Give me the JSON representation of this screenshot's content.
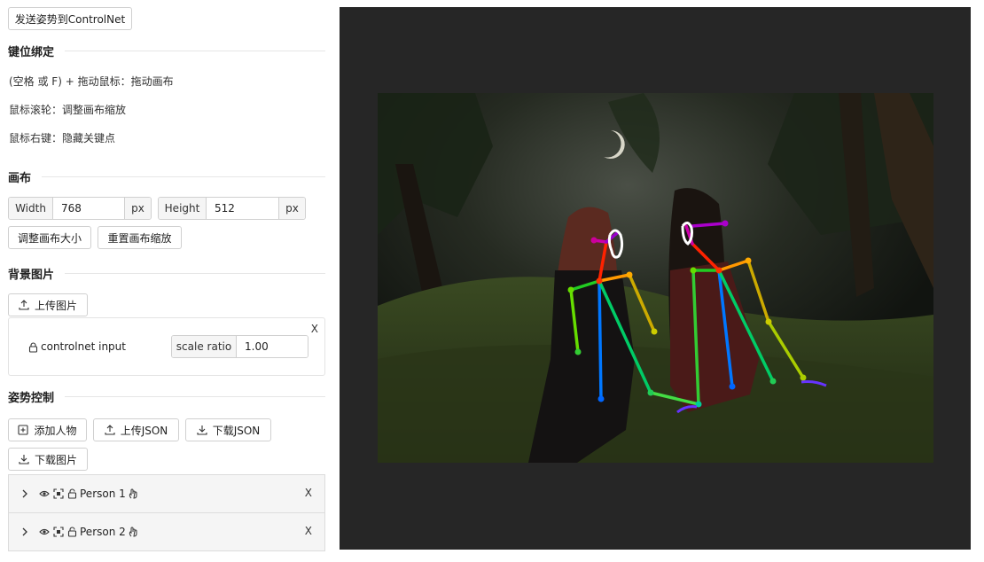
{
  "toolbar": {
    "send_label": "发送姿势到ControlNet"
  },
  "keybindings": {
    "title": "键位绑定",
    "items": [
      "(空格 或 F) + 拖动鼠标：拖动画布",
      "鼠标滚轮：调整画布缩放",
      "鼠标右键：隐藏关键点"
    ]
  },
  "canvas_section": {
    "title": "画布",
    "width_label": "Width",
    "width_value": "768",
    "width_unit": "px",
    "height_label": "Height",
    "height_value": "512",
    "height_unit": "px",
    "resize_label": "调整画布大小",
    "reset_zoom_label": "重置画布缩放"
  },
  "background": {
    "title": "背景图片",
    "upload_label": "上传图片",
    "image_name": "controlnet input",
    "scale_label": "scale ratio",
    "scale_value": "1.00",
    "close_label": "X"
  },
  "pose": {
    "title": "姿势控制",
    "add_person_label": "添加人物",
    "upload_json_label": "上传JSON",
    "download_json_label": "下载JSON",
    "download_image_label": "下载图片",
    "persons": [
      {
        "name": "Person 1",
        "remove_label": "X"
      },
      {
        "name": "Person 2",
        "remove_label": "X"
      }
    ]
  },
  "colors": {
    "canvas_bg": "#262626",
    "border": "#d0d0d0",
    "addon_bg": "#f5f5f5"
  }
}
